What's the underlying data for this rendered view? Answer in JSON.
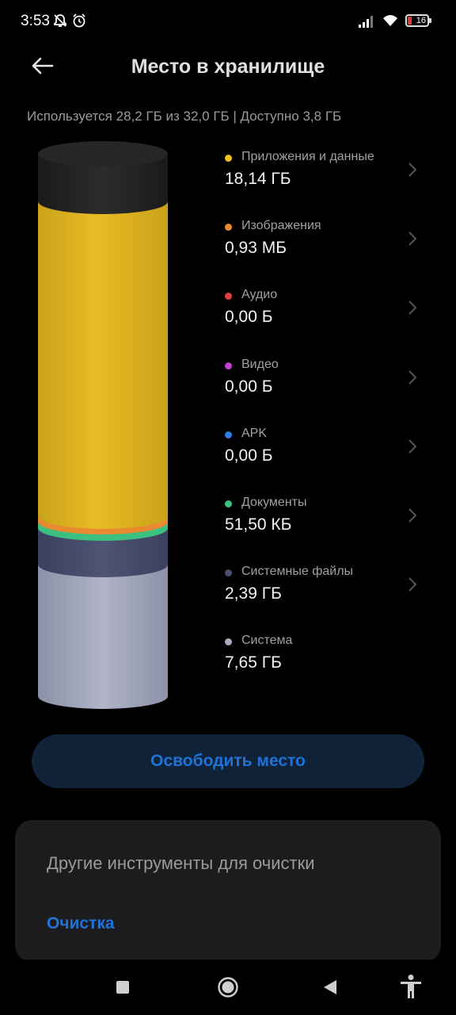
{
  "status_bar": {
    "time": "3:53",
    "battery_level": "16",
    "icons": [
      "bell-off-icon",
      "alarm-icon",
      "signal-icon",
      "wifi-icon",
      "battery-icon"
    ]
  },
  "header": {
    "title": "Место в хранилище",
    "back_icon": "arrow-left-icon"
  },
  "usage": {
    "text": "Используется 28,2 ГБ из 32,0 ГБ | Доступно 3,8 ГБ"
  },
  "categories": [
    {
      "label": "Приложения и данные",
      "value": "18,14 ГБ",
      "color": "#f0c020",
      "has_chevron": true
    },
    {
      "label": "Изображения",
      "value": "0,93 МБ",
      "color": "#e88a30",
      "has_chevron": true
    },
    {
      "label": "Аудио",
      "value": "0,00 Б",
      "color": "#e04040",
      "has_chevron": true
    },
    {
      "label": "Видео",
      "value": "0,00 Б",
      "color": "#c040d0",
      "has_chevron": true
    },
    {
      "label": "APK",
      "value": "0,00 Б",
      "color": "#2f7de0",
      "has_chevron": true
    },
    {
      "label": "Документы",
      "value": "51,50 КБ",
      "color": "#3cc080",
      "has_chevron": true
    },
    {
      "label": "Системные файлы",
      "value": "2,39 ГБ",
      "color": "#4a4f70",
      "has_chevron": true
    },
    {
      "label": "Система",
      "value": "7,65 ГБ",
      "color": "#a8acc0",
      "has_chevron": false
    }
  ],
  "colors": {
    "accent": "#1e73d8",
    "free_space": "#2a2a2a",
    "apps": "#f0c020",
    "images": "#e88a30",
    "documents": "#3cc080",
    "system_files": "#4a4f70",
    "system": "#a8acc0"
  },
  "actions": {
    "free_space_button": "Освободить место"
  },
  "tools": {
    "title": "Другие инструменты для очистки",
    "cleanup_link": "Очистка"
  },
  "nav": {
    "icons": [
      "recents-square-icon",
      "home-circle-icon",
      "back-triangle-icon",
      "accessibility-icon"
    ]
  }
}
